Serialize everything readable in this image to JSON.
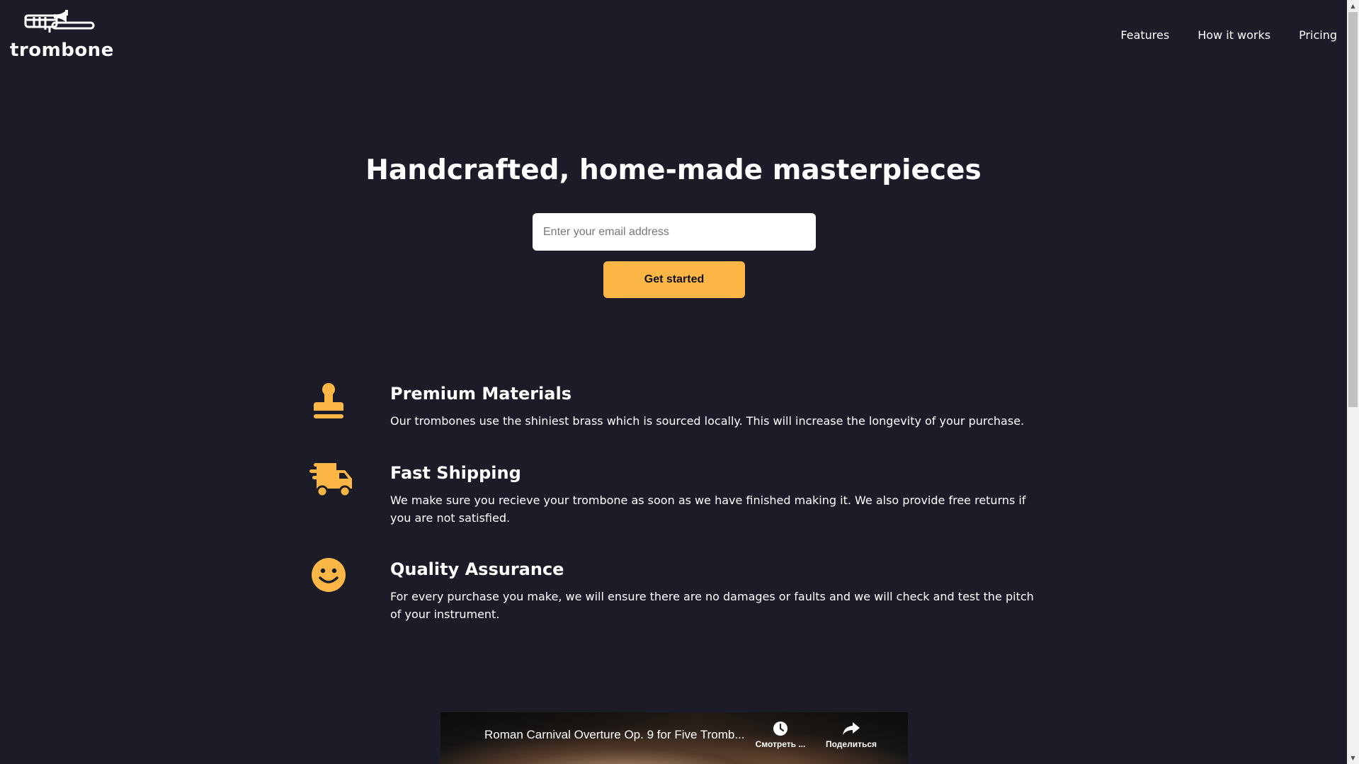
{
  "brand": {
    "name": "trombone",
    "logo_icon": "trombone-icon"
  },
  "nav": {
    "items": [
      {
        "label": "Features"
      },
      {
        "label": "How it works"
      },
      {
        "label": "Pricing"
      }
    ]
  },
  "hero": {
    "title": "Handcrafted, home-made masterpieces",
    "email_placeholder": "Enter your email address",
    "email_value": "",
    "cta_label": "Get started"
  },
  "features": [
    {
      "icon": "stamp-icon",
      "title": "Premium Materials",
      "text": "Our trombones use the shiniest brass which is sourced locally. This will increase the longevity of your purchase."
    },
    {
      "icon": "shipping-truck-icon",
      "title": "Fast Shipping",
      "text": "We make sure you recieve your trombone as soon as we have finished making it. We also provide free returns if you are not satisfied."
    },
    {
      "icon": "smile-icon",
      "title": "Quality Assurance",
      "text": "For every purchase you make, we will ensure there are no damages or faults and we will check and test the pitch of your instrument."
    }
  ],
  "video": {
    "title": "Roman Carnival Overture Op. 9 for Five Tromb...",
    "watch_later_label": "Смотреть ...",
    "share_label": "Поделиться"
  },
  "colors": {
    "background": "#1b1c27",
    "accent": "#fcb646",
    "text": "#ffffff"
  }
}
